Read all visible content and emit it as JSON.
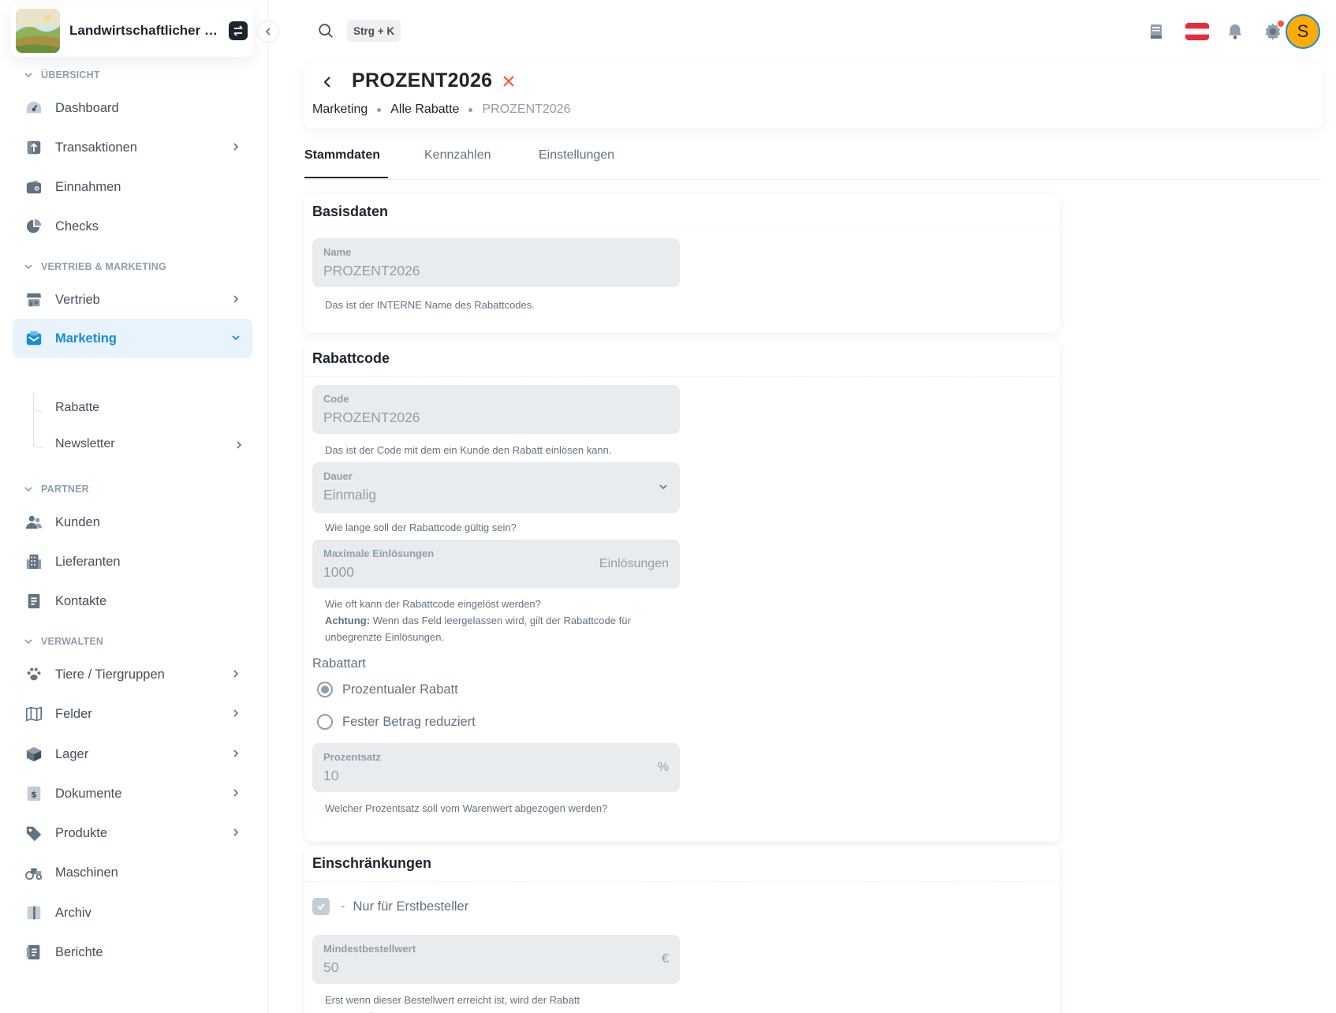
{
  "brand": {
    "name": "Landwirtschaftlicher B..."
  },
  "topbar": {
    "search_shortcut": "Strg + K",
    "avatar_letter": "S"
  },
  "sidebar": {
    "sections": [
      {
        "label": "ÜBERSICHT"
      },
      {
        "label": "VERTRIEB & MARKETING"
      },
      {
        "label": "PARTNER"
      },
      {
        "label": "VERWALTEN"
      }
    ],
    "items": [
      {
        "label": "Dashboard"
      },
      {
        "label": "Transaktionen"
      },
      {
        "label": "Einnahmen"
      },
      {
        "label": "Checks"
      },
      {
        "label": "Vertrieb"
      },
      {
        "label": "Marketing"
      },
      {
        "label": "Kunden"
      },
      {
        "label": "Lieferanten"
      },
      {
        "label": "Kontakte"
      },
      {
        "label": "Tiere / Tiergruppen"
      },
      {
        "label": "Felder"
      },
      {
        "label": "Lager"
      },
      {
        "label": "Dokumente"
      },
      {
        "label": "Produkte"
      },
      {
        "label": "Maschinen"
      },
      {
        "label": "Archiv"
      },
      {
        "label": "Berichte"
      }
    ],
    "sub_items": [
      {
        "label": "Rabatte"
      },
      {
        "label": "Newsletter"
      }
    ]
  },
  "header": {
    "title": "PROZENT2026",
    "breadcrumbs": [
      "Marketing",
      "Alle Rabatte",
      "PROZENT2026"
    ]
  },
  "tabs": [
    "Stammdaten",
    "Kennzahlen",
    "Einstellungen"
  ],
  "basisdaten": {
    "title": "Basisdaten",
    "name_label": "Name",
    "name_value": "PROZENT2026",
    "name_help": "Das ist der INTERNE Name des Rabattcodes."
  },
  "rabattcode": {
    "title": "Rabattcode",
    "code_label": "Code",
    "code_value": "PROZENT2026",
    "code_help": "Das ist der Code mit dem ein Kunde den Rabatt einlösen kann.",
    "dauer_label": "Dauer",
    "dauer_value": "Einmalig",
    "dauer_help": "Wie lange soll der Rabattcode gültig sein?",
    "max_label": "Maximale Einlösungen",
    "max_value": "1000",
    "max_suffix": "Einlösungen",
    "max_help_1": "Wie oft kann der Rabattcode eingelöst werden?",
    "max_help_bold": "Achtung:",
    "max_help_2": "Wenn das Feld leergelassen wird, gilt der Rabattcode für unbegrenzte Einlösungen.",
    "rabattart_label": "Rabattart",
    "option_percent": "Prozentualer Rabatt",
    "option_fixed": "Fester Betrag reduziert",
    "percent_label": "Prozentsatz",
    "percent_value": "10",
    "percent_suffix": "%",
    "percent_help": "Welcher Prozentsatz soll vom Warenwert abgezogen werden?"
  },
  "einschraenkungen": {
    "title": "Einschränkungen",
    "dash": "-",
    "first_order_label": "Nur für Erstbesteller",
    "min_label": "Mindestbestellwert",
    "min_value": "50",
    "min_suffix": "€",
    "min_help": "Erst wenn dieser Bestellwert erreicht ist, wird der Rabatt angewendet."
  }
}
